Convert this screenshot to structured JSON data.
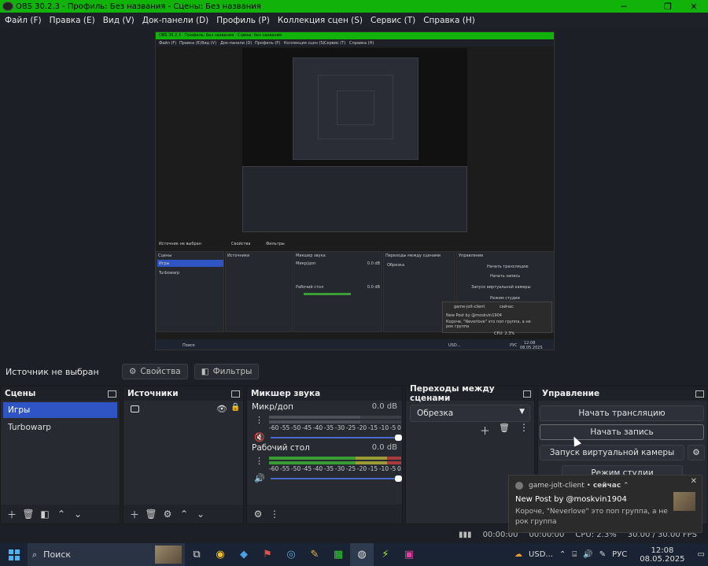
{
  "window": {
    "title": "OBS 30.2.3 - Профиль: Без названия - Сцены: Без названия",
    "minimize": "─",
    "maximize": "❐",
    "close": "✕"
  },
  "menu": [
    "Файл (F)",
    "Правка (E)",
    "Вид (V)",
    "Док-панели (D)",
    "Профиль (P)",
    "Коллекция сцен (S)",
    "Сервис (T)",
    "Справка (H)"
  ],
  "source_bar": {
    "label": "Источник не выбран",
    "properties": "Свойства",
    "filters": "Фильтры"
  },
  "scenes": {
    "title": "Сцены",
    "items": [
      "Игры",
      "Turbowarp"
    ],
    "selected": 0
  },
  "sources": {
    "title": "Источники"
  },
  "mixer": {
    "title": "Микшер звука",
    "scale": [
      "-60",
      "-55",
      "-50",
      "-45",
      "-40",
      "-35",
      "-30",
      "-25",
      "-20",
      "-15",
      "-10",
      "-5",
      "0"
    ],
    "channels": [
      {
        "name": "Микр/доп",
        "db": "0.0 dB",
        "muted": true
      },
      {
        "name": "Рабочий стол",
        "db": "0.0 dB",
        "muted": false
      }
    ]
  },
  "transitions": {
    "title": "Переходы между сценами",
    "selected": "Обрезка"
  },
  "controls": {
    "title": "Управление",
    "start_stream": "Начать трансляцию",
    "start_record": "Начать запись",
    "virtual_cam": "Запуск виртуальной камеры",
    "studio_mode": "Режим студии"
  },
  "status": {
    "time1": "00:00:00",
    "time2": "00:00:00",
    "cpu": "CPU: 2.3%",
    "fps": "30.00 / 30.00 FPS"
  },
  "notification": {
    "app": "game-jolt-client",
    "when": "сейчас",
    "title": "New Post by @moskvin1904",
    "body": "Короче, \"Neverlove\" это поп группа, а не рок группа"
  },
  "taskbar": {
    "search": "Поиск",
    "weather": "USD...",
    "lang": "РУС",
    "time": "12:08",
    "date": "08.05.2025"
  },
  "nested": {
    "title": "OBS 30.2.3 - Профиль: Без названия - Сцены: Без названия",
    "menu": [
      "Файл (F)",
      "Правка (E)",
      "Вид (V)",
      "Док-панели (D)",
      "Профиль (P)",
      "Коллекция сцен (S)",
      "Сервис (T)",
      "Справка (H)"
    ],
    "source_label": "Источник не выбран",
    "properties": "Свойства",
    "filters": "Фильтры",
    "scenes": "Сцены",
    "sources": "Источники",
    "mixer": "Микшер звука",
    "transitions": "Переходы между сценами",
    "controls": "Управление",
    "scene1": "Игры",
    "scene2": "Turbowarp",
    "mic": "Микр/доп",
    "desktop": "Рабочий стол",
    "db": "0.0 dB",
    "crop": "Обрезка",
    "start_stream": "Начать трансляцию",
    "start_record": "Начать запись",
    "virtual_cam": "Запуск виртуальной камеры",
    "studio_mode": "Режим студии",
    "n_app": "game-jolt-client",
    "n_when": "сейчас",
    "n_title": "New Post by @moskvin1904",
    "n_body": "Короче, \"Neverlove\" это поп группа, а не рок группа",
    "search": "Поиск",
    "weather": "USD...",
    "lang": "РУС",
    "time": "12:08",
    "date": "08.05.2025",
    "cpu": "CPU: 2.3%"
  }
}
